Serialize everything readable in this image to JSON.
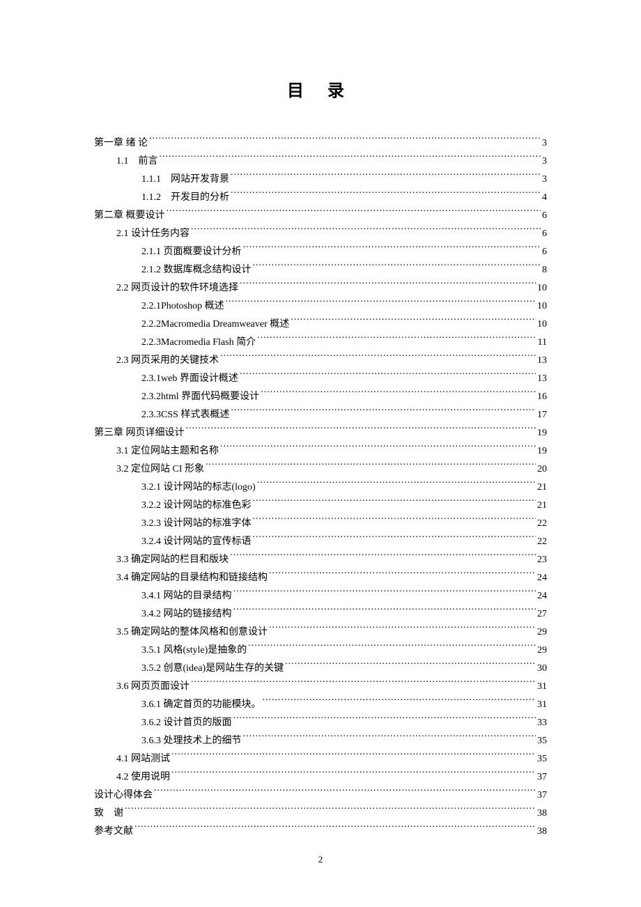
{
  "title": "目 录",
  "page_number": "2",
  "toc": [
    {
      "level": 1,
      "label": "第一章  绪 论",
      "page": "3"
    },
    {
      "level": 2,
      "label": "1.1　前言",
      "page": "3"
    },
    {
      "level": 3,
      "label": "1.1.1　网站开发背景",
      "page": "3"
    },
    {
      "level": 3,
      "label": "1.1.2　开发目的分析",
      "page": "4"
    },
    {
      "level": 1,
      "label": "第二章  概要设计",
      "page": "6"
    },
    {
      "level": 2,
      "label": "2.1 设计任务内容",
      "page": "6"
    },
    {
      "level": 3,
      "label": "2.1.1 页面概要设计分析",
      "page": "6"
    },
    {
      "level": 3,
      "label": "2.1.2 数据库概念结构设计",
      "page": "8"
    },
    {
      "level": 2,
      "label": "2.2 网页设计的软件环境选择",
      "page": "10"
    },
    {
      "level": 3,
      "label": "2.2.1Photoshop 概述",
      "page": "10"
    },
    {
      "level": 3,
      "label": "2.2.2Macromedia Dreamweaver 概述",
      "page": "10"
    },
    {
      "level": 3,
      "label": "2.2.3Macromedia Flash  简介",
      "page": "11"
    },
    {
      "level": 2,
      "label": "2.3 网页采用的关键技术",
      "page": "13"
    },
    {
      "level": 3,
      "label": "2.3.1web 界面设计概述",
      "page": "13"
    },
    {
      "level": 3,
      "label": "2.3.2html 界面代码概要设计",
      "page": "16"
    },
    {
      "level": 3,
      "label": "2.3.3CSS 样式表概述",
      "page": "17"
    },
    {
      "level": 1,
      "label": "第三章  网页详细设计",
      "page": "19"
    },
    {
      "level": 2,
      "label": "3.1 定位网站主题和名称",
      "page": "19"
    },
    {
      "level": 2,
      "label": "3.2 定位网站 CI 形象",
      "page": "20"
    },
    {
      "level": 3,
      "label": "3.2.1 设计网站的标志(logo)",
      "page": "21"
    },
    {
      "level": 3,
      "label": "3.2.2 设计网站的标准色彩",
      "page": "21"
    },
    {
      "level": 3,
      "label": "3.2.3 设计网站的标准字体",
      "page": "22"
    },
    {
      "level": 3,
      "label": "3.2.4 设计网站的宣传标语",
      "page": "22"
    },
    {
      "level": 2,
      "label": "3.3 确定网站的栏目和版块",
      "page": "23"
    },
    {
      "level": 2,
      "label": "3.4 确定网站的目录结构和链接结构",
      "page": "24"
    },
    {
      "level": 3,
      "label": "3.4.1 网站的目录结构",
      "page": "24"
    },
    {
      "level": 3,
      "label": "3.4.2 网站的链接结构",
      "page": "27"
    },
    {
      "level": 2,
      "label": "3.5 确定网站的整体风格和创意设计",
      "page": "29"
    },
    {
      "level": 3,
      "label": "3.5.1 风格(style)是抽象的",
      "page": "29"
    },
    {
      "level": 3,
      "label": "3.5.2 创意(idea)是网站生存的关键",
      "page": "30"
    },
    {
      "level": 2,
      "label": "3.6 网页页面设计",
      "page": "31"
    },
    {
      "level": 3,
      "label": "3.6.1 确定首页的功能模块。",
      "page": "31"
    },
    {
      "level": 3,
      "label": "3.6.2 设计首页的版面",
      "page": "33"
    },
    {
      "level": 3,
      "label": "3.6.3 处理技术上的细节",
      "page": "35"
    },
    {
      "level": 2,
      "label": "4.1 网站测试",
      "page": "35"
    },
    {
      "level": 2,
      "label": "4.2 使用说明",
      "page": "37"
    },
    {
      "level": 1,
      "label": "设计心得体会",
      "page": "37"
    },
    {
      "level": 1,
      "label": "致　谢",
      "page": "38"
    },
    {
      "level": 1,
      "label": "参考文献",
      "page": "38"
    }
  ]
}
